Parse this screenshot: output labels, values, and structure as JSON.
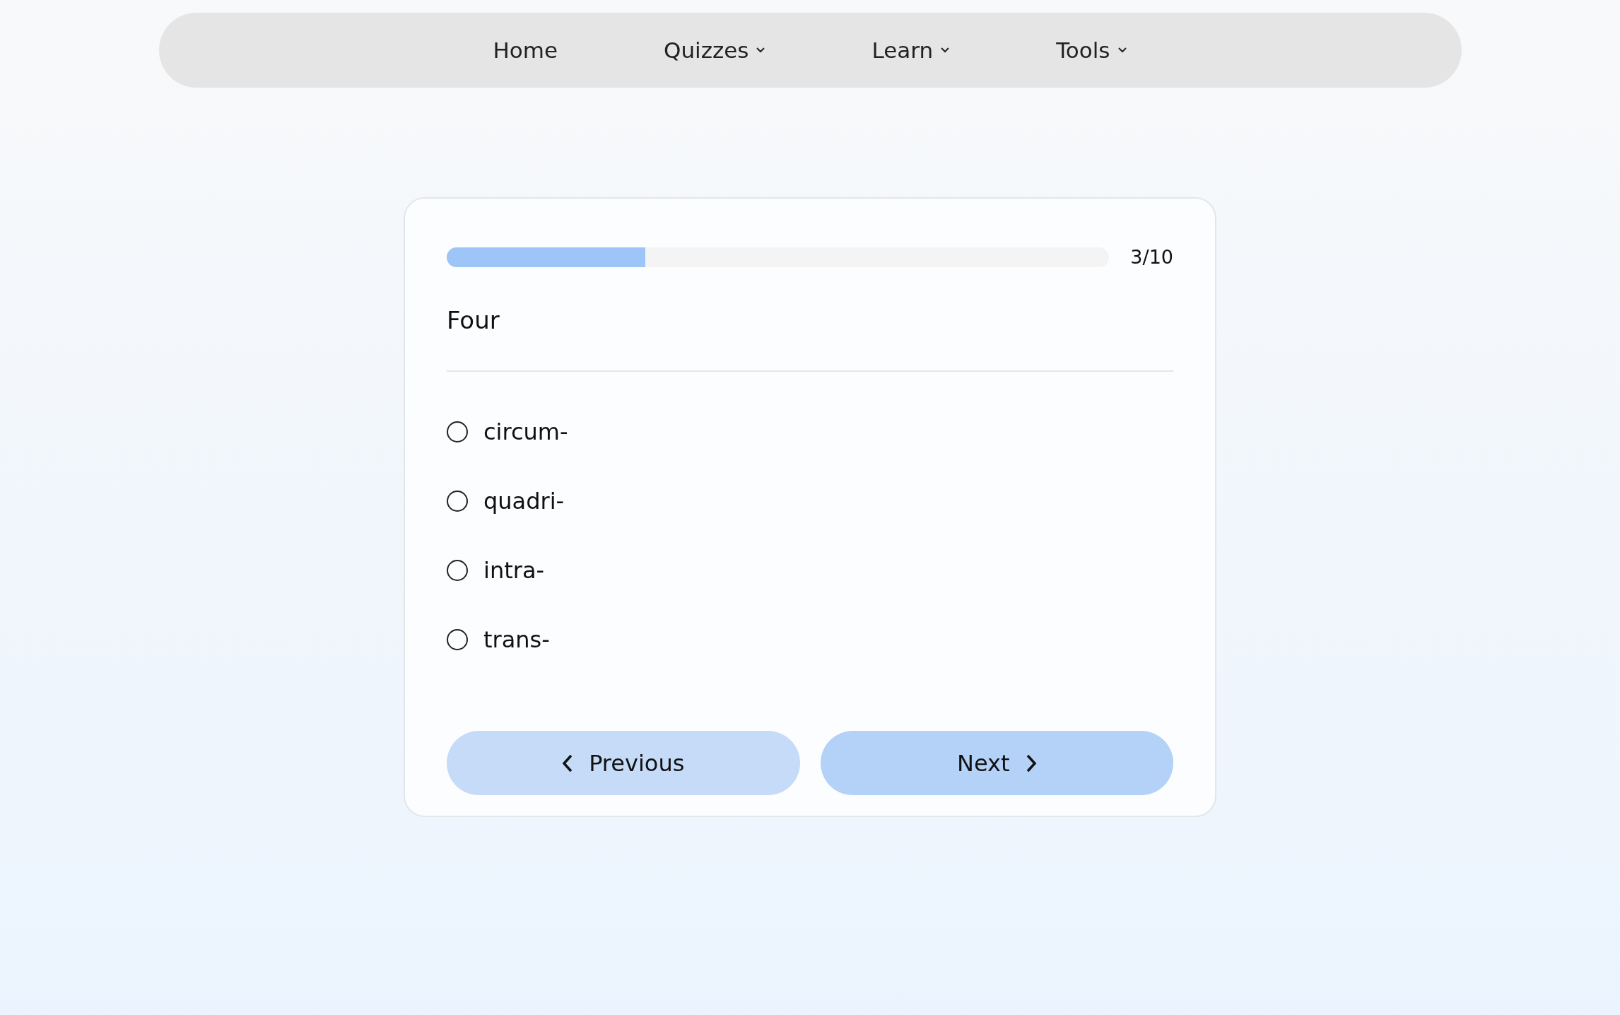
{
  "nav": {
    "items": [
      {
        "label": "Home",
        "has_menu": false
      },
      {
        "label": "Quizzes",
        "has_menu": true
      },
      {
        "label": "Learn",
        "has_menu": true
      },
      {
        "label": "Tools",
        "has_menu": true
      }
    ]
  },
  "quiz": {
    "progress": {
      "level": 0.3,
      "label": "3/10"
    },
    "question": "Four",
    "options": [
      {
        "label": "circum-",
        "selected": false
      },
      {
        "label": "quadri-",
        "selected": false
      },
      {
        "label": "intra-",
        "selected": false
      },
      {
        "label": "trans-",
        "selected": false
      }
    ],
    "buttons": [
      {
        "kind": "previous",
        "label": "Previous"
      },
      {
        "kind": "next",
        "label": "Next"
      }
    ]
  }
}
